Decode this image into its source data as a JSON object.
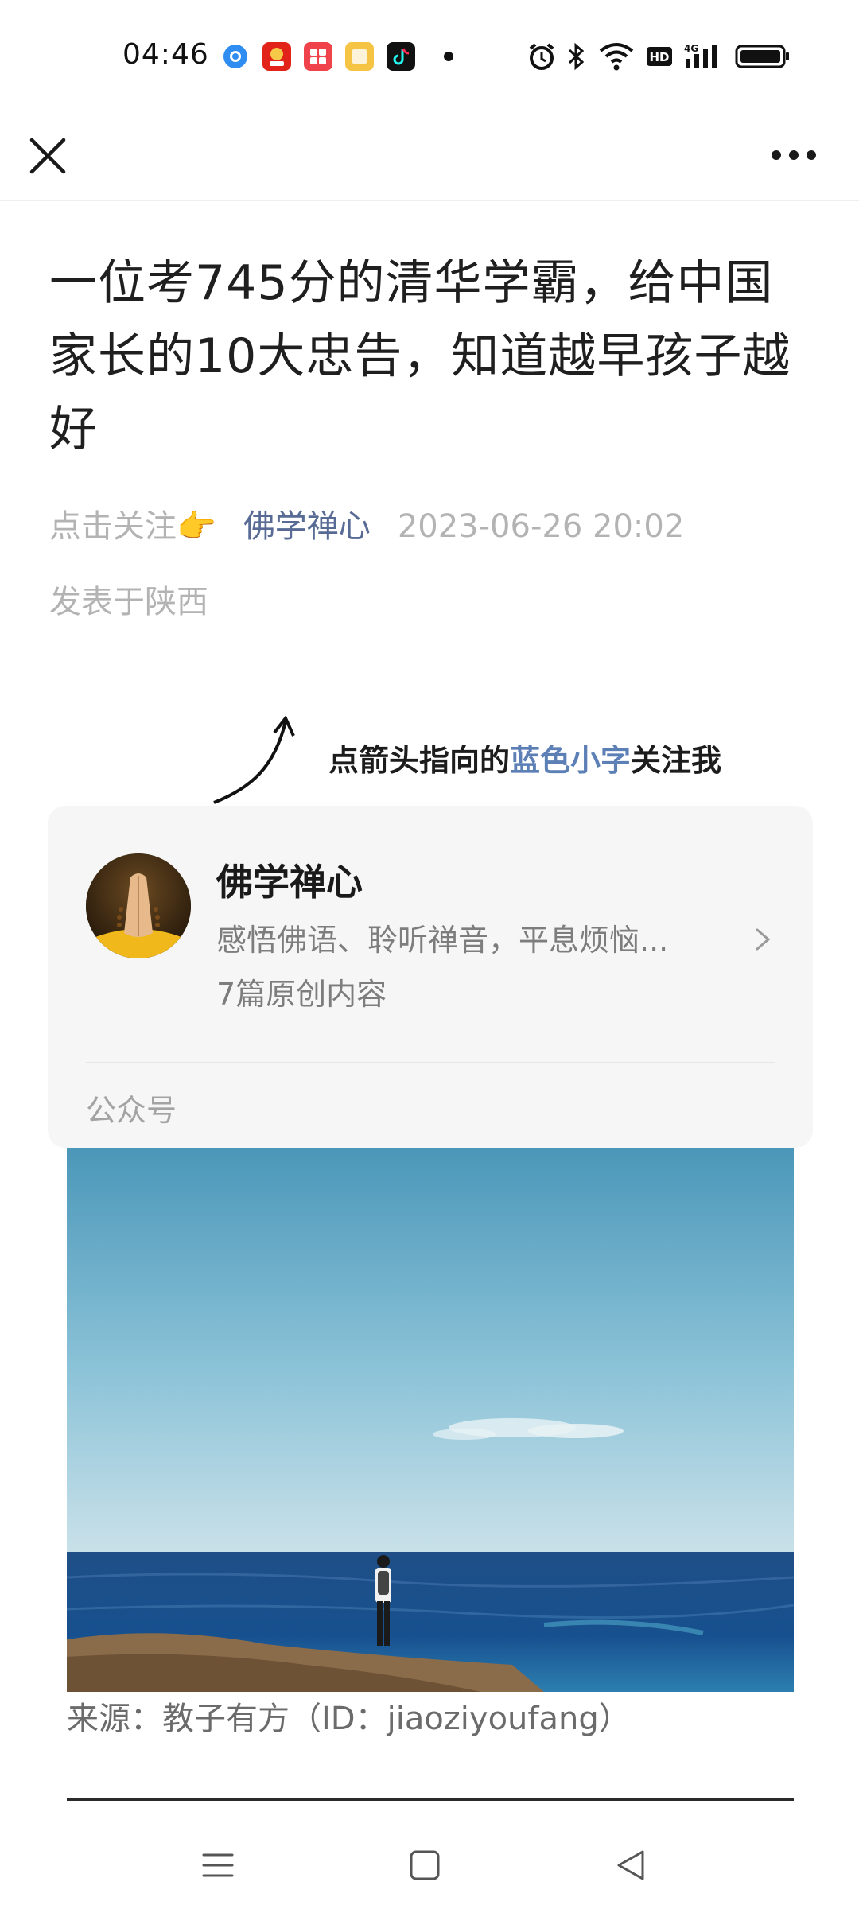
{
  "status_bar": {
    "time": "04:46",
    "app_icons": [
      "browser-icon",
      "shopping-618-icon",
      "red-app-icon",
      "yellow-reader-icon",
      "tiktok-icon"
    ],
    "system_icons": [
      "alarm-icon",
      "bluetooth-icon",
      "wifi-icon",
      "hd-icon",
      "4g-signal-icon",
      "battery-icon"
    ]
  },
  "nav": {
    "close_icon": "close-icon",
    "more_icon": "more-dots-icon"
  },
  "article": {
    "title": "一位考745分的清华学霸，给中国家长的10大忠告，知道越早孩子越好",
    "follow_prompt": "点击关注👉",
    "author": "佛学禅心",
    "date": "2023-06-26 20:02",
    "location": "发表于陕西"
  },
  "follow_hint": {
    "text_before": "点箭头指向的",
    "text_blue": "蓝色小字",
    "text_after": "关注我"
  },
  "profile_card": {
    "name": "佛学禅心",
    "description": "感悟佛语、聆听禅音，平息烦恼...",
    "count": "7篇原创内容",
    "type": "公众号"
  },
  "image_caption": "来源：教子有方（ID：jiaoziyoufang）",
  "bottom_nav": {
    "menu_icon": "menu-icon",
    "home_icon": "home-square-icon",
    "back_icon": "back-triangle-icon"
  }
}
